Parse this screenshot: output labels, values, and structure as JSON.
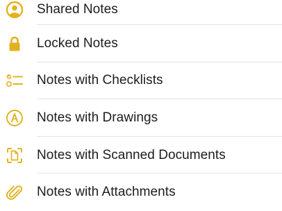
{
  "accent_color": "#e2b21e",
  "folders": [
    {
      "label": "Shared Notes",
      "icon": "person-circle-icon"
    },
    {
      "label": "Locked Notes",
      "icon": "lock-icon"
    },
    {
      "label": "Notes with Checklists",
      "icon": "checklist-icon"
    },
    {
      "label": "Notes with Drawings",
      "icon": "pencil-tip-circle-icon"
    },
    {
      "label": "Notes with Scanned Documents",
      "icon": "doc-scanner-icon"
    },
    {
      "label": "Notes with Attachments",
      "icon": "paperclip-icon"
    }
  ]
}
